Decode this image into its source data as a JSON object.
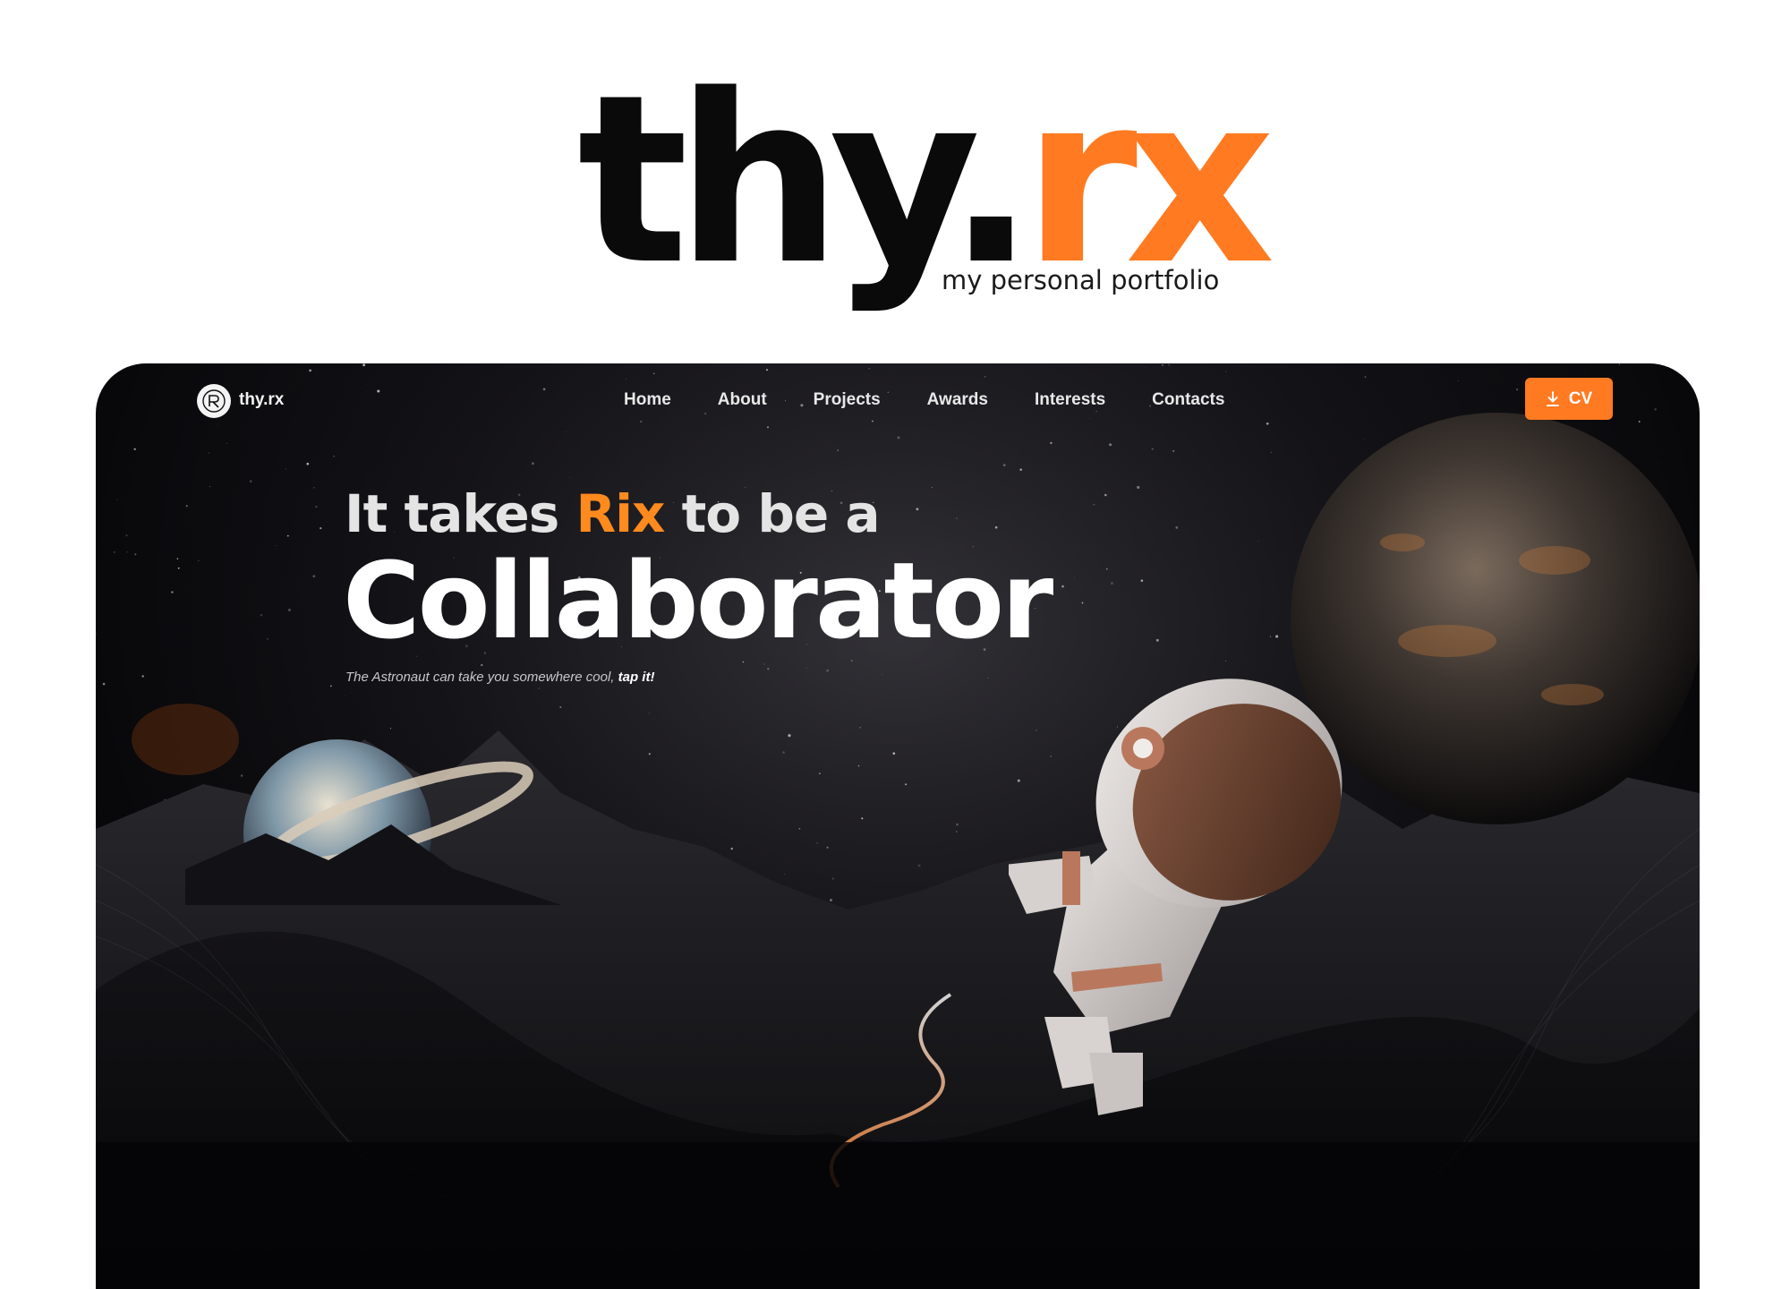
{
  "brand": {
    "logo_part1": "thy",
    "logo_dot": ".",
    "logo_part2": "rx",
    "tagline": "my personal portfolio"
  },
  "nav": {
    "brand": "thy.rx",
    "links": [
      "Home",
      "About",
      "Projects",
      "Awards",
      "Interests",
      "Contacts"
    ],
    "cv_label": "CV"
  },
  "hero": {
    "line1_before": "It takes ",
    "line1_accent": "Rix",
    "line1_after": " to be a",
    "title": "Collaborator",
    "sub_text": "The Astronaut can take you somewhere cool, ",
    "sub_bold": "tap it!"
  },
  "icons": {
    "nav_logo": "rx-monogram-icon",
    "cv": "download-icon"
  },
  "colors": {
    "accent": "#ff7a21",
    "background": "#0b0b0e",
    "text": "#ffffff"
  }
}
